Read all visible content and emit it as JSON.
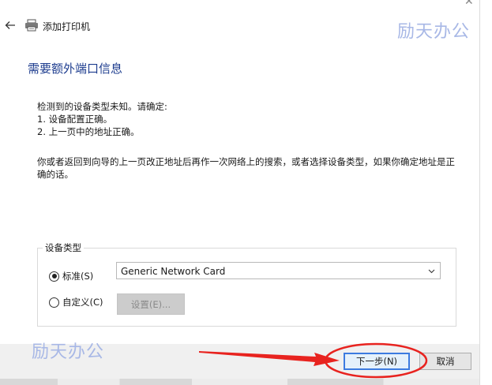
{
  "window": {
    "title": "添加打印机",
    "close_glyph": "✕"
  },
  "watermark": {
    "top": "励天办公",
    "bottom": "励天办公"
  },
  "page": {
    "title": "需要额外端口信息",
    "lines": [
      "检测到的设备类型未知。请确定:",
      "1. 设备配置正确。",
      "2. 上一页中的地址正确。"
    ],
    "paragraph": "你或者返回到向导的上一页改正地址后再作一次网络上的搜索，或者选择设备类型，如果你确定地址是正确的话。"
  },
  "device_type": {
    "group_label": "设备类型",
    "standard_label": "标准(S)",
    "custom_label": "自定义(C)",
    "selected": "standard",
    "select_value": "Generic Network Card",
    "settings_label": "设置(E)..."
  },
  "footer": {
    "next_label": "下一步(N)",
    "cancel_label": "取消"
  },
  "colors": {
    "title_blue": "#1e3d8f",
    "watermark": "#a8b8e6",
    "annotation_red": "#e8231f",
    "button_focus": "#3c7be0"
  },
  "icons": {
    "back": "back-arrow-icon",
    "printer": "printer-icon",
    "chevron": "chevron-down-icon"
  }
}
